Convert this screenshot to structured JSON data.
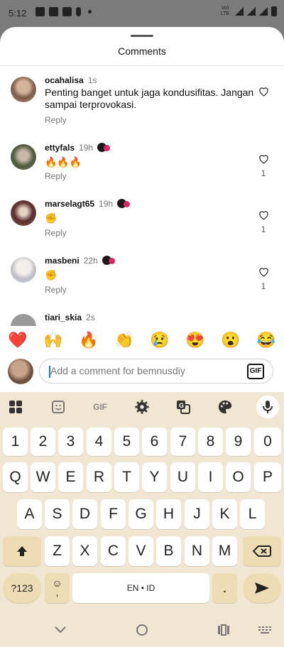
{
  "status_bar": {
    "time": "5:12",
    "network": "Vo) LTE"
  },
  "sheet": {
    "title": "Comments"
  },
  "comments": [
    {
      "user": "ocahalisa",
      "time": "1s",
      "text": "Penting banget untuk jaga kondusifitas. Jangan sampai terprovokasi.",
      "reply": "Reply",
      "likes": ""
    },
    {
      "user": "ettyfals",
      "time": "19h",
      "text": "🔥🔥🔥",
      "reply": "Reply",
      "likes": "1"
    },
    {
      "user": "marselagt65",
      "time": "19h",
      "text": "✊",
      "reply": "Reply",
      "likes": "1"
    },
    {
      "user": "masbeni",
      "time": "22h",
      "text": "✊",
      "reply": "Reply",
      "likes": "1"
    },
    {
      "user": "tiari_skia",
      "time": "2s",
      "text": "",
      "reply": "",
      "likes": ""
    }
  ],
  "emoji_bar": [
    "❤️",
    "🙌",
    "🔥",
    "👏",
    "😢",
    "😍",
    "😮",
    "😂"
  ],
  "input": {
    "placeholder": "Add a comment for bemnusdiy",
    "gif_label": "GIF"
  },
  "keyboard": {
    "toolbar_gif": "GIF",
    "row_numbers": [
      "1",
      "2",
      "3",
      "4",
      "5",
      "6",
      "7",
      "8",
      "9",
      "0"
    ],
    "row_q": [
      "Q",
      "W",
      "E",
      "R",
      "T",
      "Y",
      "U",
      "I",
      "O",
      "P"
    ],
    "row_a": [
      "A",
      "S",
      "D",
      "F",
      "G",
      "H",
      "J",
      "K",
      "L"
    ],
    "row_z": [
      "Z",
      "X",
      "C",
      "V",
      "B",
      "N",
      "M"
    ],
    "symbols_key": "?123",
    "emoji_key": "☺",
    "comma_key": ",",
    "space_label": "EN • ID",
    "period_key": "."
  }
}
